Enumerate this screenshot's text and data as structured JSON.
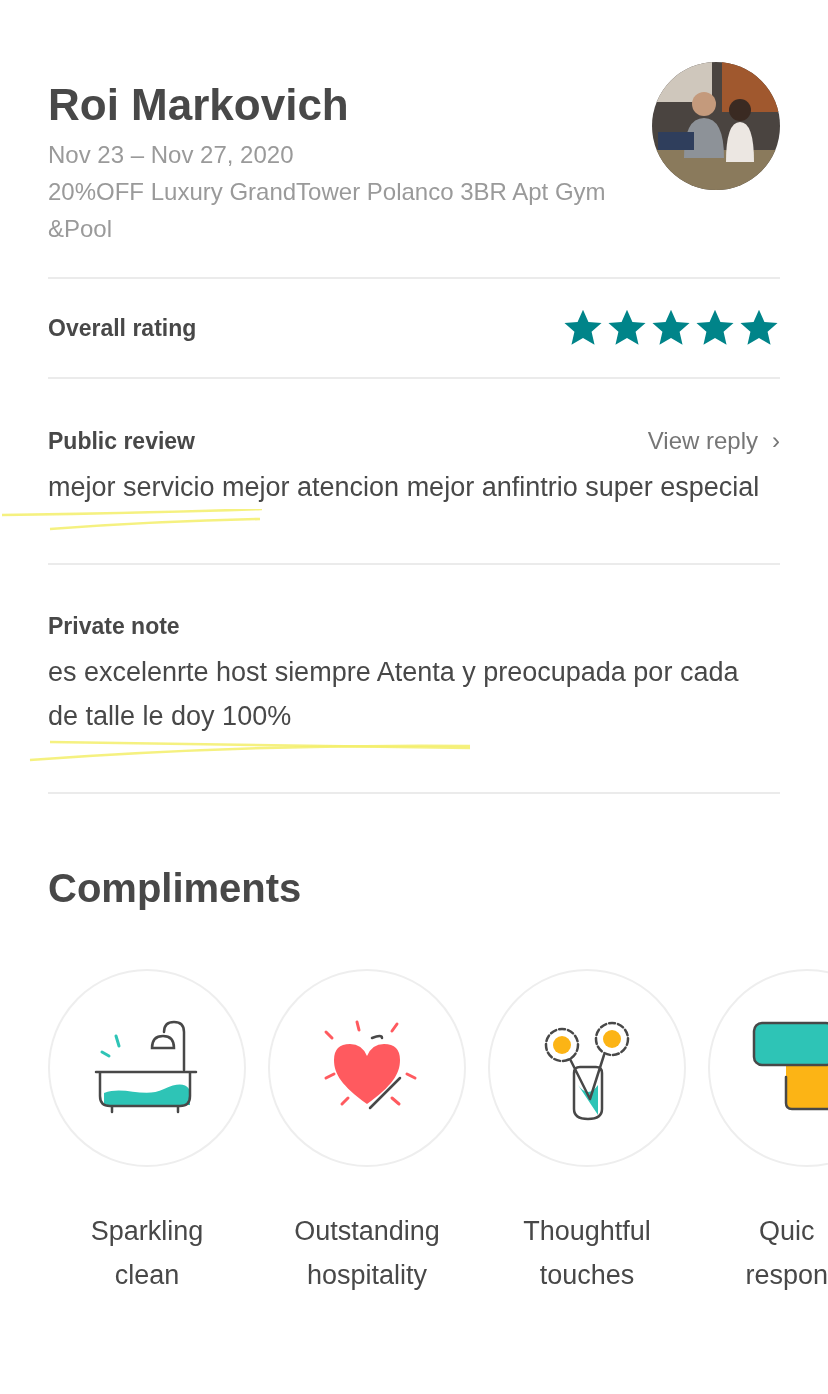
{
  "guest": {
    "name": "Roi Markovich",
    "dates": "Nov 23 – Nov 27, 2020",
    "listing": "20%OFF Luxury GrandTower Polanco 3BR Apt Gym &Pool"
  },
  "rating": {
    "label": "Overall rating",
    "stars": 5
  },
  "public_review": {
    "label": "Public review",
    "action": "View reply",
    "action_icon": "›",
    "text": "mejor servicio mejor atencion mejor anfintrio super especial",
    "highlighted": true
  },
  "private_note": {
    "label": "Private note",
    "text": "es excelenrte host siempre Atenta y preocupada por cada de talle le doy 100%",
    "highlighted": true
  },
  "compliments": {
    "title": "Compliments",
    "items": [
      {
        "kind": "bath",
        "lines": [
          "Sparkling",
          "clean"
        ]
      },
      {
        "kind": "heart",
        "lines": [
          "Outstanding",
          "hospitality"
        ]
      },
      {
        "kind": "flowers",
        "lines": [
          "Thoughtful",
          "touches"
        ]
      },
      {
        "kind": "chat",
        "lines": [
          "Quic",
          "respon"
        ]
      }
    ]
  }
}
